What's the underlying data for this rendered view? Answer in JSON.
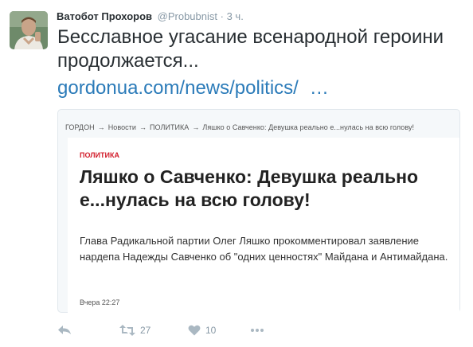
{
  "tweet": {
    "author_name": "Ватобот Прохоров",
    "handle": "@Probubnist",
    "separator": "·",
    "time": "3 ч.",
    "text": "Бесславное угасание всенародной героини продолжается...",
    "link_text": "gordonua.com/news/politics/",
    "link_ellipsis": "…"
  },
  "card": {
    "breadcrumbs": [
      "ГОРДОН",
      "Новости",
      "ПОЛИТИКА",
      "Ляшко о Савченко: Девушка реально е...нулась на всю голову!"
    ],
    "breadcrumb_separator": "→",
    "category": "ПОЛИТИКА",
    "headline": "Ляшко о Савченко: Девушка реально е...нулась на всю голову!",
    "excerpt": "Глава Радикальной партии Олег Ляшко прокомментировал заявление нардепа Надежды Савченко об \"одних ценностях\" Майдана и Антимайдана.",
    "date": "Вчера 22:27"
  },
  "actions": {
    "reply_icon": "reply-icon",
    "retweet_icon": "retweet-icon",
    "retweet_count": "27",
    "like_icon": "heart-icon",
    "like_count": "10",
    "more_icon": "more-icon"
  },
  "colors": {
    "link": "#2b7bb9",
    "muted": "#8899a6",
    "category_red": "#d21d2b",
    "card_border": "#e1e8ed"
  }
}
